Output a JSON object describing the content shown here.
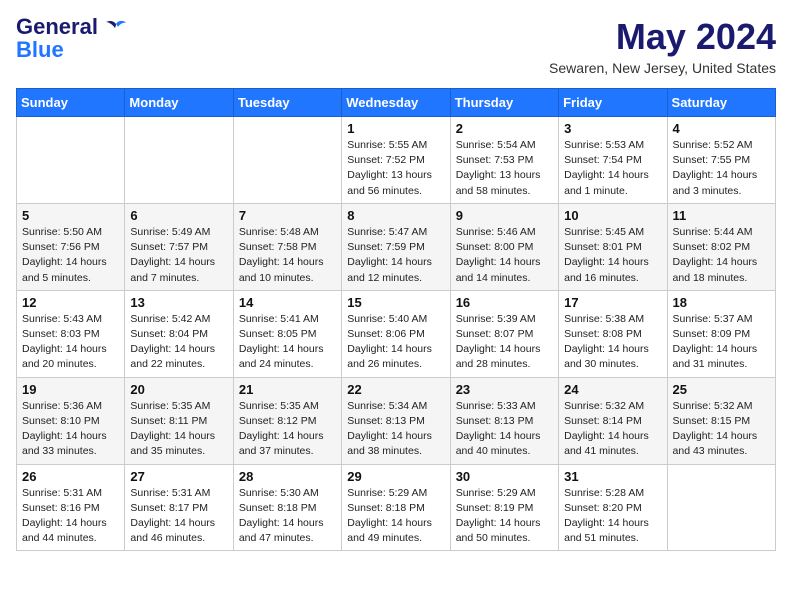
{
  "header": {
    "logo_line1": "General",
    "logo_line2": "Blue",
    "month": "May 2024",
    "location": "Sewaren, New Jersey, United States"
  },
  "weekdays": [
    "Sunday",
    "Monday",
    "Tuesday",
    "Wednesday",
    "Thursday",
    "Friday",
    "Saturday"
  ],
  "weeks": [
    [
      {
        "day": "",
        "info": ""
      },
      {
        "day": "",
        "info": ""
      },
      {
        "day": "",
        "info": ""
      },
      {
        "day": "1",
        "info": "Sunrise: 5:55 AM\nSunset: 7:52 PM\nDaylight: 13 hours\nand 56 minutes."
      },
      {
        "day": "2",
        "info": "Sunrise: 5:54 AM\nSunset: 7:53 PM\nDaylight: 13 hours\nand 58 minutes."
      },
      {
        "day": "3",
        "info": "Sunrise: 5:53 AM\nSunset: 7:54 PM\nDaylight: 14 hours\nand 1 minute."
      },
      {
        "day": "4",
        "info": "Sunrise: 5:52 AM\nSunset: 7:55 PM\nDaylight: 14 hours\nand 3 minutes."
      }
    ],
    [
      {
        "day": "5",
        "info": "Sunrise: 5:50 AM\nSunset: 7:56 PM\nDaylight: 14 hours\nand 5 minutes."
      },
      {
        "day": "6",
        "info": "Sunrise: 5:49 AM\nSunset: 7:57 PM\nDaylight: 14 hours\nand 7 minutes."
      },
      {
        "day": "7",
        "info": "Sunrise: 5:48 AM\nSunset: 7:58 PM\nDaylight: 14 hours\nand 10 minutes."
      },
      {
        "day": "8",
        "info": "Sunrise: 5:47 AM\nSunset: 7:59 PM\nDaylight: 14 hours\nand 12 minutes."
      },
      {
        "day": "9",
        "info": "Sunrise: 5:46 AM\nSunset: 8:00 PM\nDaylight: 14 hours\nand 14 minutes."
      },
      {
        "day": "10",
        "info": "Sunrise: 5:45 AM\nSunset: 8:01 PM\nDaylight: 14 hours\nand 16 minutes."
      },
      {
        "day": "11",
        "info": "Sunrise: 5:44 AM\nSunset: 8:02 PM\nDaylight: 14 hours\nand 18 minutes."
      }
    ],
    [
      {
        "day": "12",
        "info": "Sunrise: 5:43 AM\nSunset: 8:03 PM\nDaylight: 14 hours\nand 20 minutes."
      },
      {
        "day": "13",
        "info": "Sunrise: 5:42 AM\nSunset: 8:04 PM\nDaylight: 14 hours\nand 22 minutes."
      },
      {
        "day": "14",
        "info": "Sunrise: 5:41 AM\nSunset: 8:05 PM\nDaylight: 14 hours\nand 24 minutes."
      },
      {
        "day": "15",
        "info": "Sunrise: 5:40 AM\nSunset: 8:06 PM\nDaylight: 14 hours\nand 26 minutes."
      },
      {
        "day": "16",
        "info": "Sunrise: 5:39 AM\nSunset: 8:07 PM\nDaylight: 14 hours\nand 28 minutes."
      },
      {
        "day": "17",
        "info": "Sunrise: 5:38 AM\nSunset: 8:08 PM\nDaylight: 14 hours\nand 30 minutes."
      },
      {
        "day": "18",
        "info": "Sunrise: 5:37 AM\nSunset: 8:09 PM\nDaylight: 14 hours\nand 31 minutes."
      }
    ],
    [
      {
        "day": "19",
        "info": "Sunrise: 5:36 AM\nSunset: 8:10 PM\nDaylight: 14 hours\nand 33 minutes."
      },
      {
        "day": "20",
        "info": "Sunrise: 5:35 AM\nSunset: 8:11 PM\nDaylight: 14 hours\nand 35 minutes."
      },
      {
        "day": "21",
        "info": "Sunrise: 5:35 AM\nSunset: 8:12 PM\nDaylight: 14 hours\nand 37 minutes."
      },
      {
        "day": "22",
        "info": "Sunrise: 5:34 AM\nSunset: 8:13 PM\nDaylight: 14 hours\nand 38 minutes."
      },
      {
        "day": "23",
        "info": "Sunrise: 5:33 AM\nSunset: 8:13 PM\nDaylight: 14 hours\nand 40 minutes."
      },
      {
        "day": "24",
        "info": "Sunrise: 5:32 AM\nSunset: 8:14 PM\nDaylight: 14 hours\nand 41 minutes."
      },
      {
        "day": "25",
        "info": "Sunrise: 5:32 AM\nSunset: 8:15 PM\nDaylight: 14 hours\nand 43 minutes."
      }
    ],
    [
      {
        "day": "26",
        "info": "Sunrise: 5:31 AM\nSunset: 8:16 PM\nDaylight: 14 hours\nand 44 minutes."
      },
      {
        "day": "27",
        "info": "Sunrise: 5:31 AM\nSunset: 8:17 PM\nDaylight: 14 hours\nand 46 minutes."
      },
      {
        "day": "28",
        "info": "Sunrise: 5:30 AM\nSunset: 8:18 PM\nDaylight: 14 hours\nand 47 minutes."
      },
      {
        "day": "29",
        "info": "Sunrise: 5:29 AM\nSunset: 8:18 PM\nDaylight: 14 hours\nand 49 minutes."
      },
      {
        "day": "30",
        "info": "Sunrise: 5:29 AM\nSunset: 8:19 PM\nDaylight: 14 hours\nand 50 minutes."
      },
      {
        "day": "31",
        "info": "Sunrise: 5:28 AM\nSunset: 8:20 PM\nDaylight: 14 hours\nand 51 minutes."
      },
      {
        "day": "",
        "info": ""
      }
    ]
  ]
}
